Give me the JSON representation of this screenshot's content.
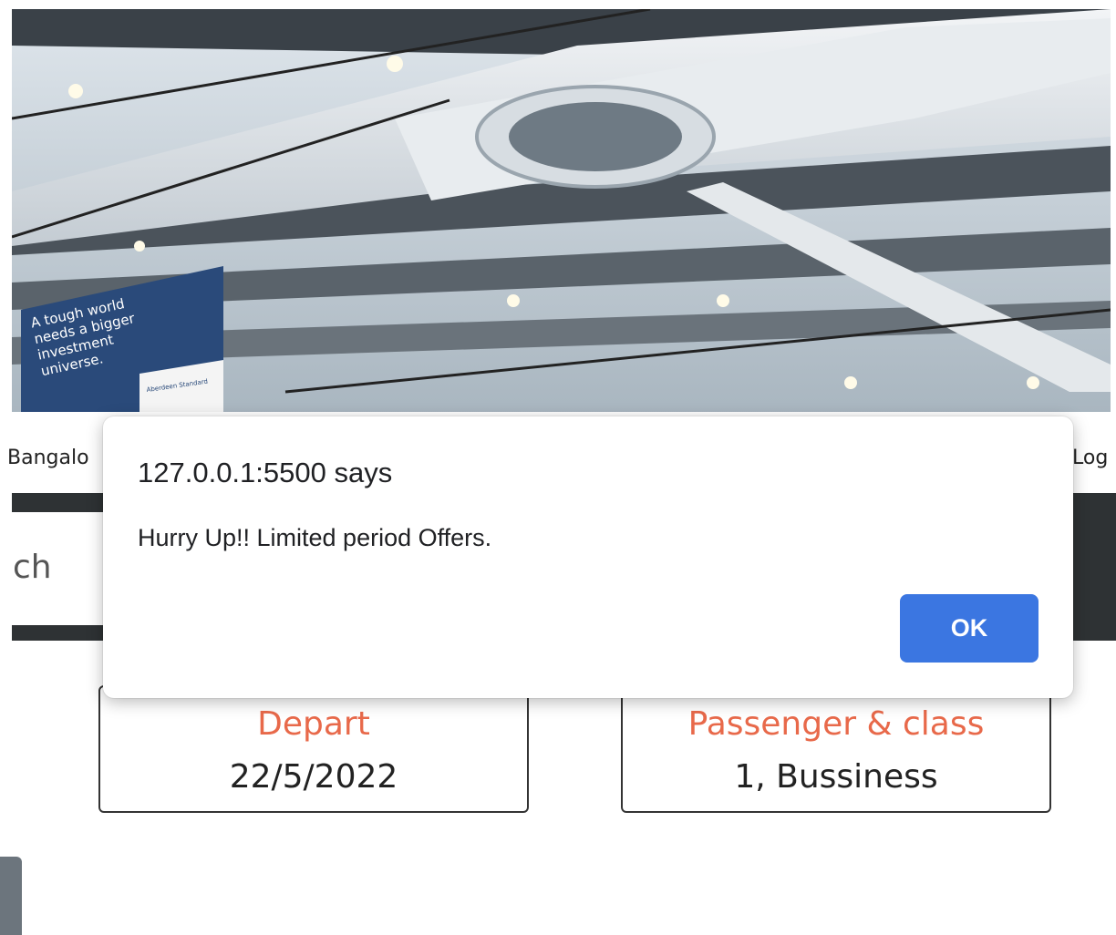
{
  "hero": {
    "banner_line_1": "A tough world",
    "banner_line_2": "needs a bigger",
    "banner_line_3": "investment",
    "banner_line_4": "universe.",
    "banner_brand": "Aberdeen Standard"
  },
  "location": {
    "left_text": "Bangalo",
    "right_text": "Log"
  },
  "search": {
    "partial_text": "ch"
  },
  "cards": [
    {
      "label": "Depart",
      "value": "22/5/2022"
    },
    {
      "label": "Passenger & class",
      "value": "1, Bussiness"
    }
  ],
  "alert": {
    "title": "127.0.0.1:5500 says",
    "message": "Hurry Up!! Limited period Offers.",
    "ok_label": "OK"
  },
  "colors": {
    "accent": "#e8694a",
    "dialog_button": "#3b76e1",
    "dark_strip": "#2e3234"
  }
}
